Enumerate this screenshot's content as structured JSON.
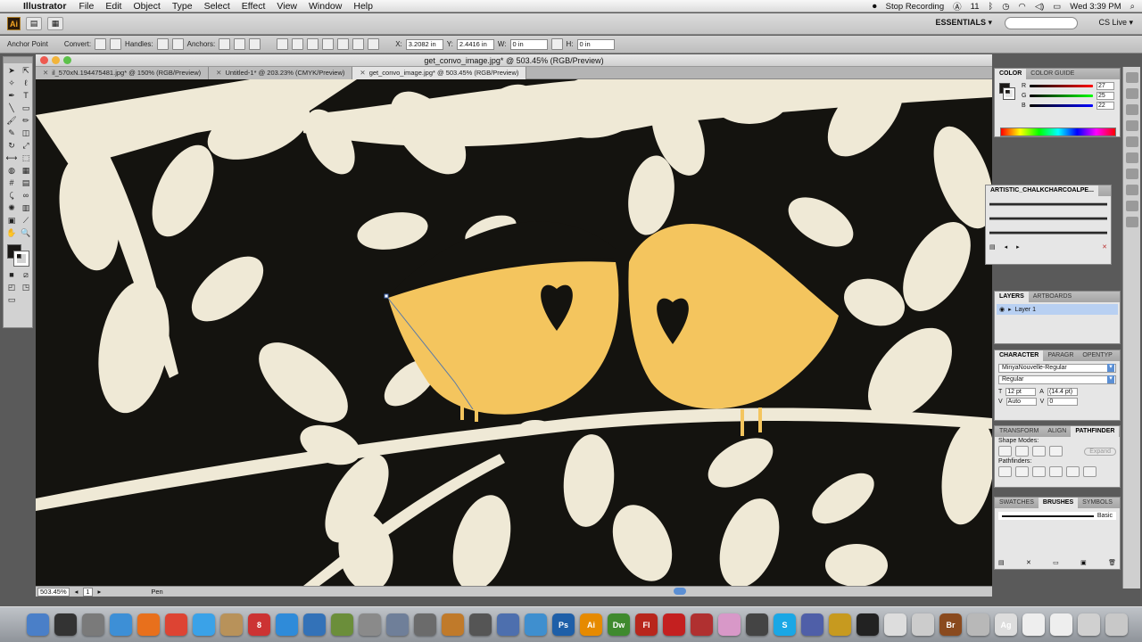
{
  "menubar": {
    "app_name": "Illustrator",
    "items": [
      "File",
      "Edit",
      "Object",
      "Type",
      "Select",
      "Effect",
      "View",
      "Window",
      "Help"
    ],
    "stop_recording": "Stop Recording",
    "adobe_count": "11",
    "clock": "Wed 3:39 PM"
  },
  "appbar": {
    "workspace": "ESSENTIALS ▾",
    "search_placeholder": "",
    "cs_live": "CS Live ▾"
  },
  "controlbar": {
    "anchor_point": "Anchor Point",
    "convert": "Convert:",
    "handles": "Handles:",
    "anchors": "Anchors:",
    "x_label": "X:",
    "x_value": "3.2082 in",
    "y_label": "Y:",
    "y_value": "2.4416 in",
    "w_label": "W:",
    "w_value": "0 in",
    "h_label": "H:",
    "h_value": "0 in"
  },
  "document": {
    "title": "get_convo_image.jpg* @ 503.45% (RGB/Preview)",
    "tabs": [
      {
        "label": "il_570xN.194475481.jpg* @ 150% (RGB/Preview)"
      },
      {
        "label": "Untitled-1* @ 203.23% (CMYK/Preview)"
      },
      {
        "label": "get_convo_image.jpg* @ 503.45% (RGB/Preview)"
      }
    ],
    "zoom": "503.45%",
    "artboard": "1",
    "status_tool": "Pen"
  },
  "colors": {
    "canvas_bg": "#14130f",
    "leaf": "#efe9d6",
    "bird": "#f4c55e",
    "accent": "#5b8fd4"
  },
  "color_panel": {
    "tabs": [
      "COLOR",
      "COLOR GUIDE"
    ],
    "r_label": "R",
    "r_value": "27",
    "g_label": "G",
    "g_value": "25",
    "b_label": "B",
    "b_value": "22"
  },
  "brush_library": {
    "title": "ARTISTIC_CHALKCHARCOALPE..."
  },
  "layers_panel": {
    "tabs": [
      "LAYERS",
      "ARTBOARDS"
    ],
    "layer_name": "Layer 1"
  },
  "character_panel": {
    "tabs": [
      "CHARACTER",
      "PARAGR",
      "OPENTYP"
    ],
    "font": "MinyaNouvelle-Regular",
    "style": "Regular",
    "size": "12 pt",
    "leading": "(14.4 pt)",
    "kerning": "Auto",
    "tracking": "0"
  },
  "pathfinder_panel": {
    "tabs": [
      "TRANSFORM",
      "ALIGN",
      "PATHFINDER"
    ],
    "shape_modes": "Shape Modes:",
    "expand": "Expand",
    "pathfinders": "Pathfinders:"
  },
  "brushes_panel": {
    "tabs": [
      "SWATCHES",
      "BRUSHES",
      "SYMBOLS"
    ],
    "brush_name": "Basic"
  },
  "dock": {
    "icons": [
      {
        "name": "finder-icon",
        "label": "",
        "color": "#4a7fc8"
      },
      {
        "name": "dashboard-icon",
        "label": "",
        "color": "#333333"
      },
      {
        "name": "system-prefs-icon",
        "label": "",
        "color": "#7a7a7a"
      },
      {
        "name": "safari-icon",
        "label": "",
        "color": "#3d8fd6"
      },
      {
        "name": "firefox-icon",
        "label": "",
        "color": "#e8701c"
      },
      {
        "name": "chrome-icon",
        "label": "",
        "color": "#dd4433"
      },
      {
        "name": "facetime-icon",
        "label": "",
        "color": "#3aa2e8"
      },
      {
        "name": "addressbook-icon",
        "label": "",
        "color": "#b8925a"
      },
      {
        "name": "ical-icon",
        "label": "8",
        "color": "#cc3333"
      },
      {
        "name": "itunes-icon",
        "label": "",
        "color": "#2f8bd9"
      },
      {
        "name": "quicktime-icon",
        "label": "",
        "color": "#3372b8"
      },
      {
        "name": "iphoto-icon",
        "label": "",
        "color": "#6b8e3a"
      },
      {
        "name": "star-app-icon",
        "label": "",
        "color": "#8a8a8a"
      },
      {
        "name": "expose-icon",
        "label": "",
        "color": "#6f7f99"
      },
      {
        "name": "prefs-gear-icon",
        "label": "",
        "color": "#6b6b6b"
      },
      {
        "name": "preview-icon",
        "label": "",
        "color": "#c07a2a"
      },
      {
        "name": "script-icon",
        "label": "",
        "color": "#555555"
      },
      {
        "name": "app-pen-icon",
        "label": "",
        "color": "#4d6fae"
      },
      {
        "name": "app-brush-icon",
        "label": "",
        "color": "#3f8fcf"
      },
      {
        "name": "photoshop-icon",
        "label": "Ps",
        "color": "#1e5fa8"
      },
      {
        "name": "illustrator-icon",
        "label": "Ai",
        "color": "#e68a00"
      },
      {
        "name": "dreamweaver-icon",
        "label": "Dw",
        "color": "#3f8a2e"
      },
      {
        "name": "flash-icon",
        "label": "Fl",
        "color": "#b8261c"
      },
      {
        "name": "acrobat-icon",
        "label": "",
        "color": "#c42020"
      },
      {
        "name": "pdf-app-icon",
        "label": "",
        "color": "#b03030"
      },
      {
        "name": "pig-app-icon",
        "label": "",
        "color": "#d898c8"
      },
      {
        "name": "clapper-icon",
        "label": "",
        "color": "#444444"
      },
      {
        "name": "skype-icon",
        "label": "S",
        "color": "#1aa7e5"
      },
      {
        "name": "globe-app-icon",
        "label": "",
        "color": "#4f5fa8"
      },
      {
        "name": "filezilla-icon",
        "label": "",
        "color": "#c79a1f"
      },
      {
        "name": "terminal-icon",
        "label": "",
        "color": "#222222"
      },
      {
        "name": "textedit-icon",
        "label": "",
        "color": "#dddddd"
      },
      {
        "name": "scissors-app-icon",
        "label": "",
        "color": "#cccccc"
      },
      {
        "name": "bridge-icon",
        "label": "Br",
        "color": "#8a4a1e"
      },
      {
        "name": "pencil-app-icon",
        "label": "",
        "color": "#b8b8b8"
      },
      {
        "name": "font-app-icon",
        "label": "Ag",
        "color": "#dddddd"
      },
      {
        "name": "doc-icon",
        "label": "",
        "color": "#eeeeee"
      },
      {
        "name": "doc2-icon",
        "label": "",
        "color": "#eeeeee"
      },
      {
        "name": "folder-stack-icon",
        "label": "",
        "color": "#d0d0d0"
      },
      {
        "name": "trash-icon",
        "label": "",
        "color": "#c8c8c8"
      }
    ]
  }
}
